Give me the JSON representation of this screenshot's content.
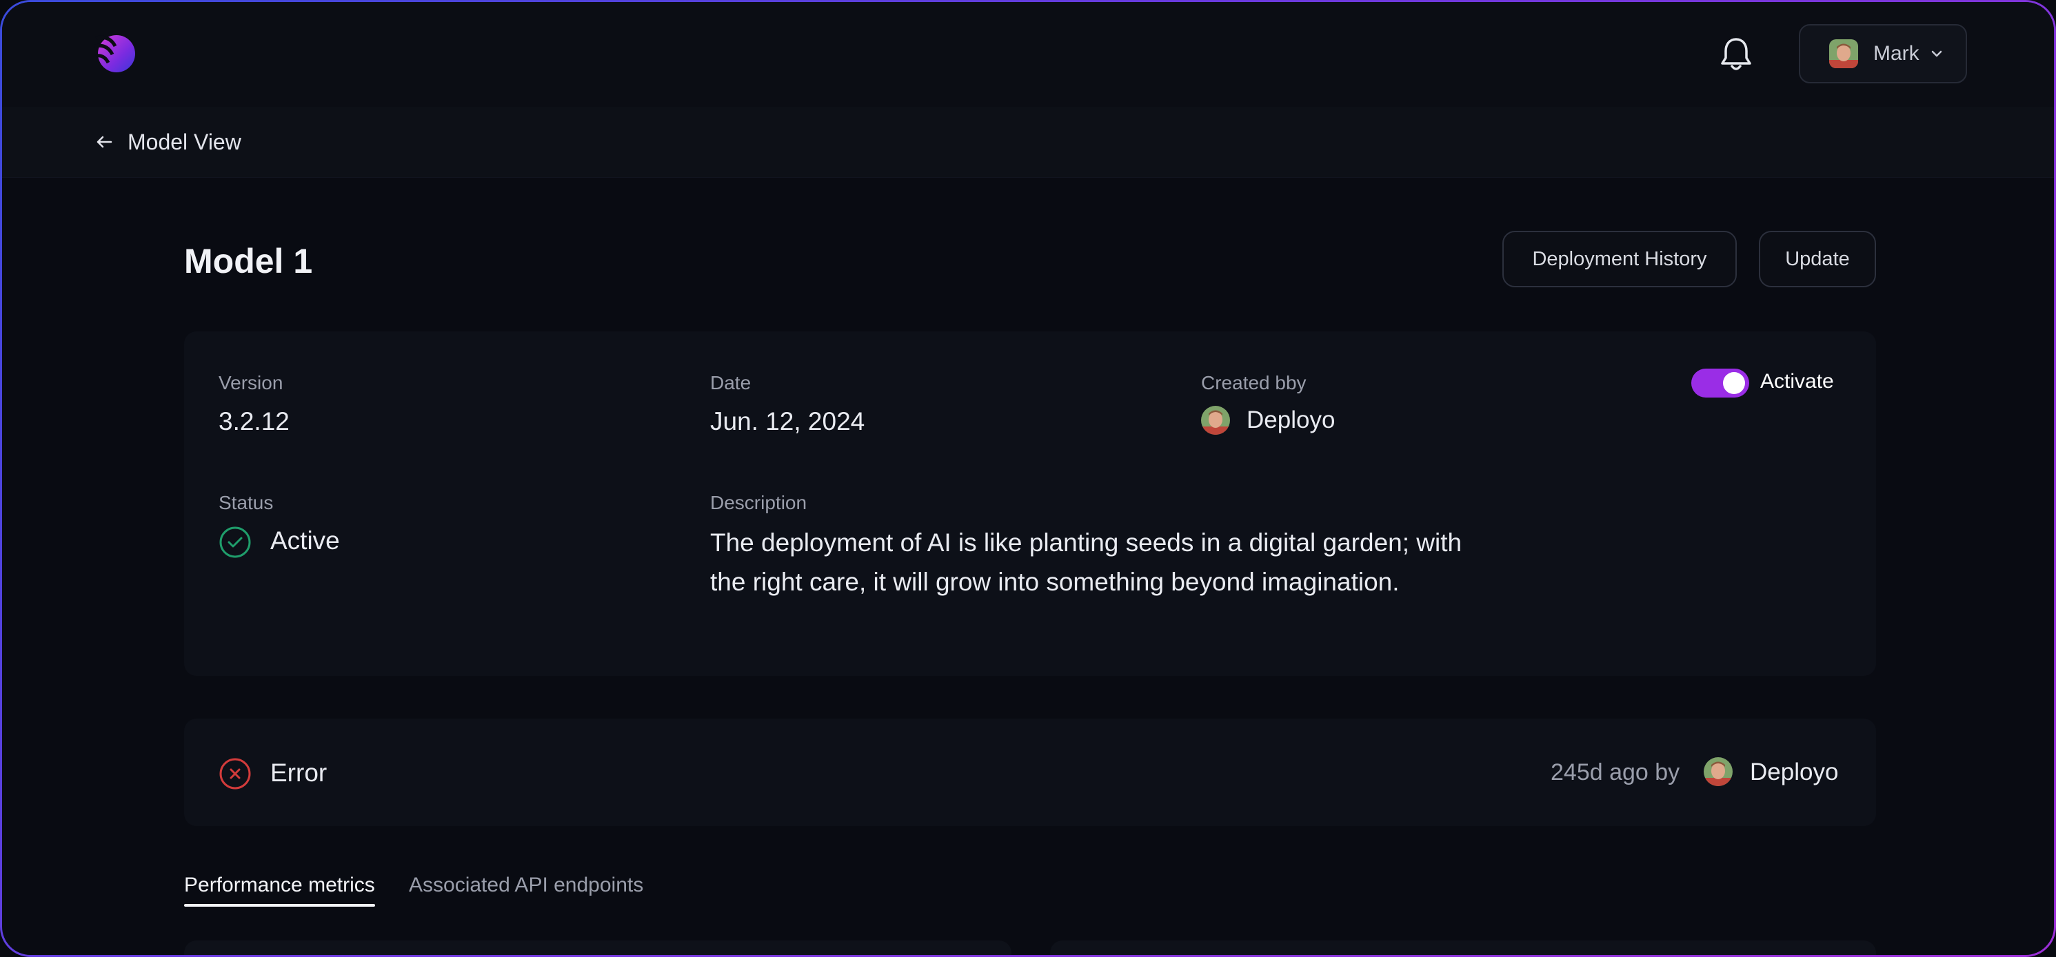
{
  "header": {
    "logo": "app-logo",
    "notifications_icon": "bell-icon",
    "user": {
      "name": "Mark",
      "avatar": "user-avatar"
    }
  },
  "nav": {
    "back_label": "Model View"
  },
  "model": {
    "title": "Model 1",
    "actions": {
      "history_label": "Deployment History",
      "update_label": "Update"
    },
    "details": {
      "version_label": "Version",
      "version_value": "3.2.12",
      "date_label": "Date",
      "date_value": "Jun. 12, 2024",
      "created_label": "Created bby",
      "created_value": "Deployo",
      "status_label": "Status",
      "status_value": "Active",
      "description_label": "Description",
      "description_value": "The deployment of AI is like planting seeds in a digital garden; with the right care, it will grow into something beyond imagination.",
      "activate_label": "Activate",
      "activate_on": true
    },
    "last_event": {
      "status": "Error",
      "meta": "245d ago by",
      "author": "Deployo"
    }
  },
  "tabs": [
    {
      "label": "Performance metrics",
      "active": true
    },
    {
      "label": "Associated API endpoints",
      "active": false
    }
  ],
  "colors": {
    "accent": "#9a2de6",
    "success": "#1f9d6b",
    "error": "#d23b3b"
  }
}
